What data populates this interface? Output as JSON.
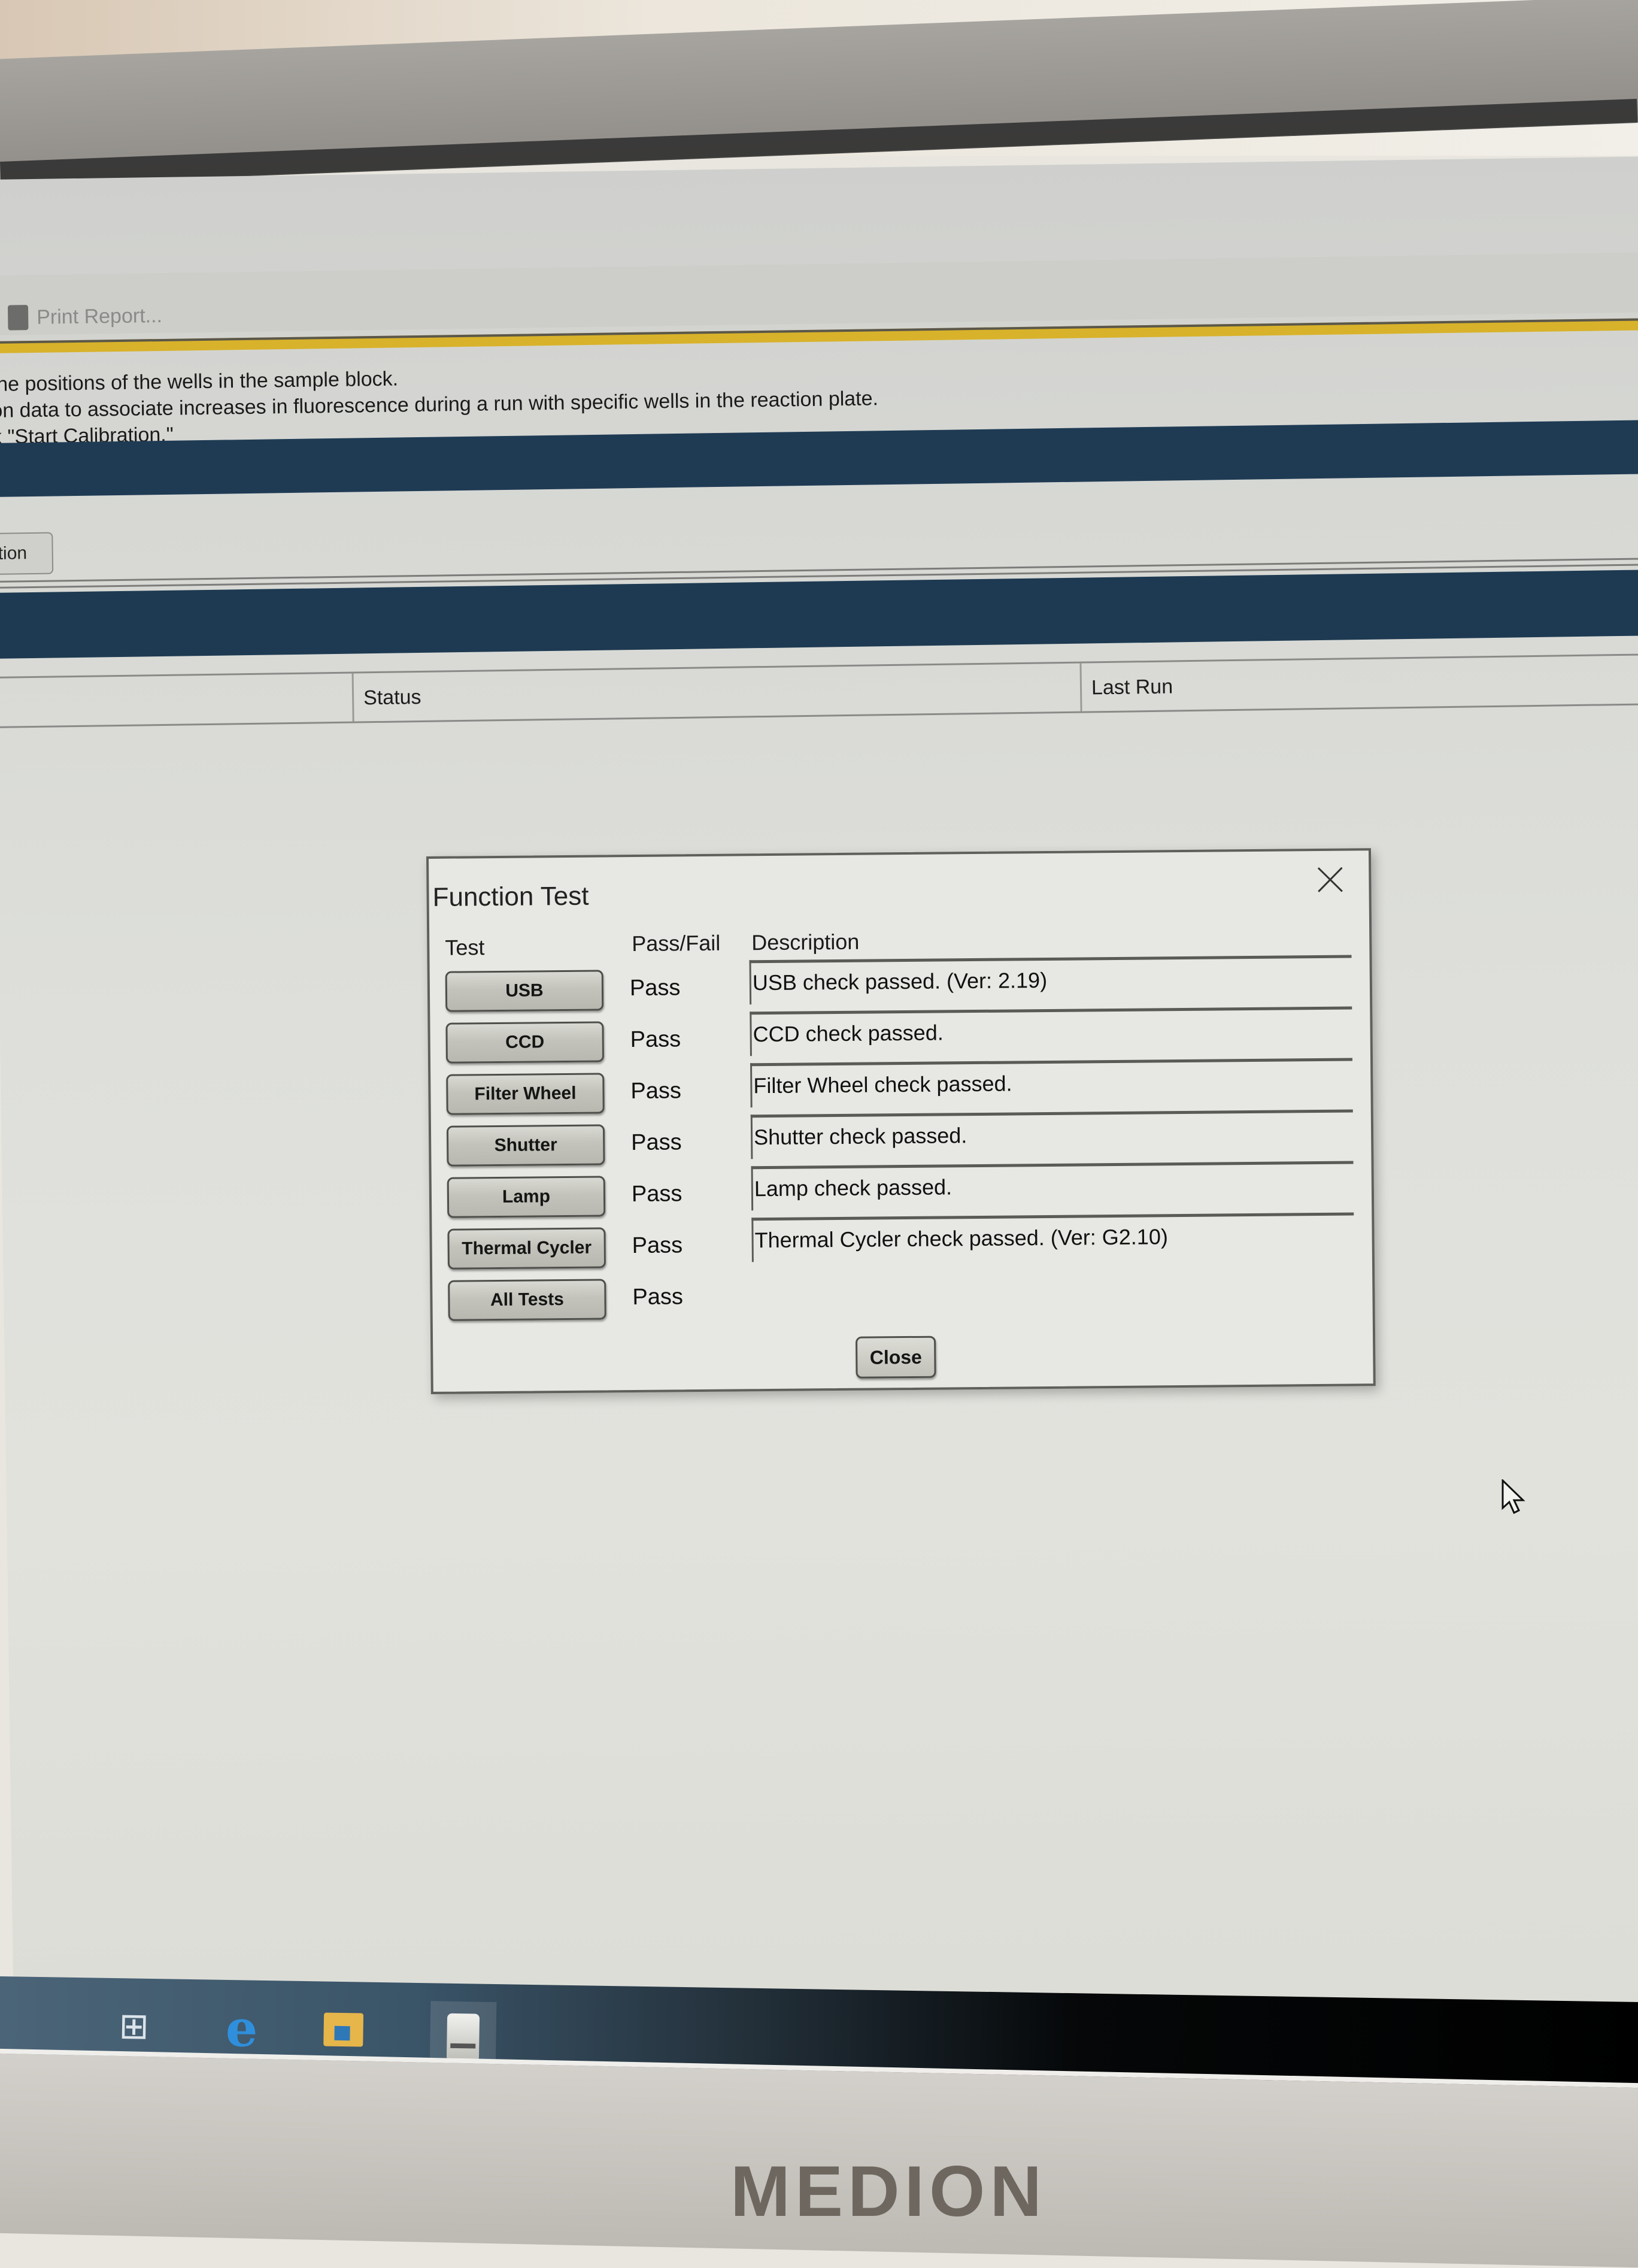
{
  "toolbar": {
    "print_report_label": "Print Report..."
  },
  "intro_text": [
    "the positions of the wells in the sample block.",
    "on data to associate increases in fluorescence during a run with specific wells in the reaction plate.",
    "k \"Start Calibration.\""
  ],
  "calibration_button_label": "tion",
  "table_header": {
    "columns": [
      "",
      "Status",
      "Last Run"
    ]
  },
  "dialog": {
    "title": "Function Test",
    "headers": {
      "test": "Test",
      "pass_fail": "Pass/Fail",
      "description": "Description"
    },
    "rows": [
      {
        "test": "USB",
        "result": "Pass",
        "description": "USB check passed. (Ver: 2.19)"
      },
      {
        "test": "CCD",
        "result": "Pass",
        "description": "CCD check passed."
      },
      {
        "test": "Filter Wheel",
        "result": "Pass",
        "description": "Filter Wheel check passed."
      },
      {
        "test": "Shutter",
        "result": "Pass",
        "description": "Shutter check passed."
      },
      {
        "test": "Lamp",
        "result": "Pass",
        "description": "Lamp check passed."
      },
      {
        "test": "Thermal Cycler",
        "result": "Pass",
        "description": "Thermal Cycler check passed. (Ver: G2.10)"
      },
      {
        "test": "All Tests",
        "result": "Pass",
        "description": ""
      }
    ],
    "close_label": "Close"
  },
  "taskbar": {
    "icons": [
      "task-view-icon",
      "edge-icon",
      "file-explorer-icon",
      "app-icon"
    ]
  },
  "monitor_brand": "MEDION",
  "colors": {
    "accent_gold": "#d8b22a",
    "header_navy": "#1f3b54"
  }
}
